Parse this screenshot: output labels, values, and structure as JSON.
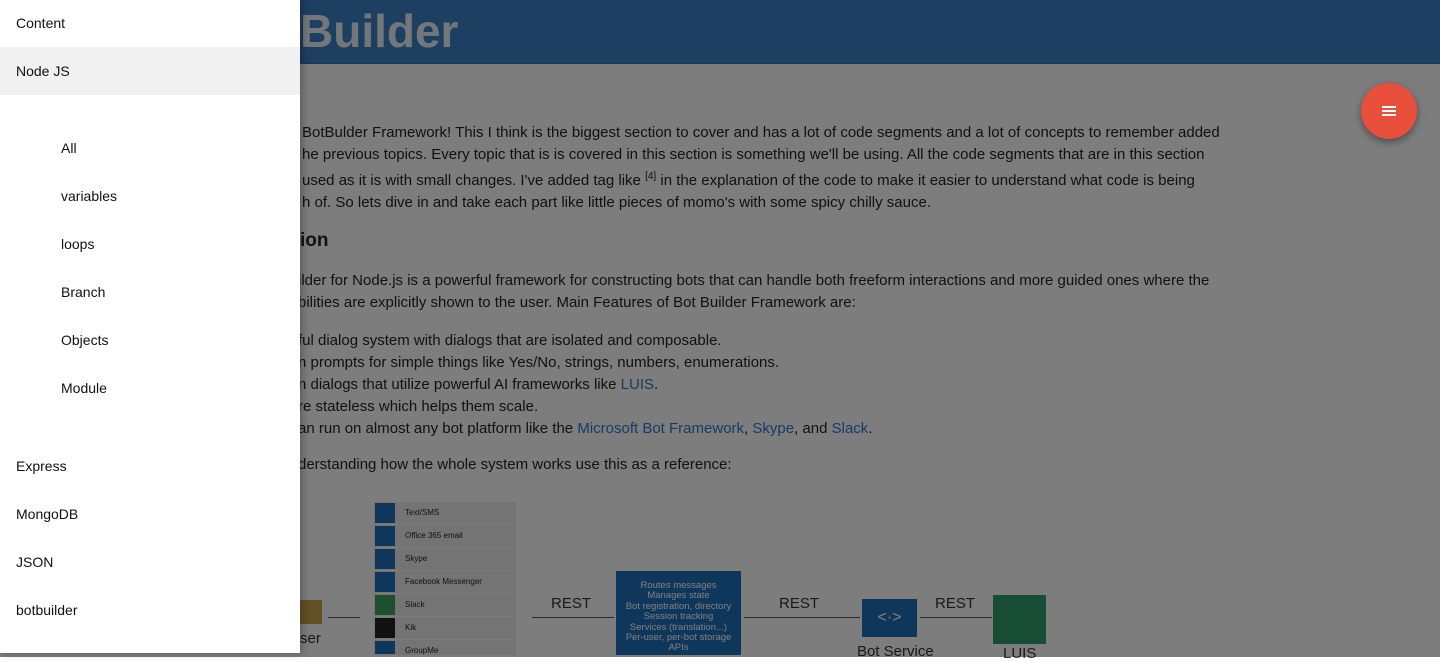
{
  "header": {
    "title": "Builder"
  },
  "intro": {
    "line1": "BotBulder Framework! This I think is the biggest section to cover and has a lot of code segments and a lot of concepts to remember added",
    "line2": "he previous topics. Every topic that is is covered in this section is something we'll be using. All the code segments that are in this section",
    "line3a": "used as it is with small changes. I've added tag like",
    "line3_sup": "[4]",
    "line3b": "in the explanation of the code to make it easier to understand what code is being",
    "line4": "h of. So lets dive in and take each part like little pieces of momo's with some spicy chilly sauce."
  },
  "section_heading": "ion",
  "desc": {
    "line1": "ilder for Node.js is a powerful framework for constructing bots that can handle both freeform interactions and more guided ones where the",
    "line2": "bilities are explicitly shown to the user. Main Features of Bot Builder Framework are:"
  },
  "features": {
    "f1": "ful dialog system with dialogs that are isolated and composable.",
    "f2": "n prompts for simple things like Yes/No, strings, numbers, enumerations.",
    "f3_text": "n dialogs that utilize powerful AI frameworks like",
    "f3_link": "LUIS",
    "f4": "re stateless which helps them scale.",
    "f5_text": "an run on almost any bot platform like the",
    "f5_link1": "Microsoft Bot Framework",
    "f5_link2": "Skype",
    "f5_and": ", and",
    "f5_link3": "Slack"
  },
  "reference": "derstanding how the whole system works use this as a reference:",
  "diagram": {
    "channels": [
      "Text/SMS",
      "Office 365 email",
      "Skype",
      "Facebook Messenger",
      "Slack",
      "Kik",
      "GroupMe"
    ],
    "rest1": "REST",
    "rest2": "REST",
    "rest3": "REST",
    "connector_lines": [
      "Routes messages",
      "Manages state",
      "Bot registration, directory",
      "Session tracking",
      "Services (translation...)",
      "Per-user, per-bot storage",
      "APIs"
    ],
    "user_label": "ser",
    "bot_service_label": "Bot Service",
    "luis_label": "LUIS"
  },
  "drawer": {
    "header": "Content",
    "active_item": "Node JS",
    "sub_items": [
      "All",
      "variables",
      "loops",
      "Branch",
      "Objects",
      "Module"
    ],
    "items": [
      "Express",
      "MongoDB",
      "JSON",
      "botbuilder"
    ]
  },
  "colors": {
    "header_bg": "#3a7fc5",
    "fab_bg": "#e8503c",
    "link": "#2b78c8",
    "overlay": "rgba(0,0,0,0.5)"
  },
  "icons": {
    "fab": "menu-icon"
  }
}
